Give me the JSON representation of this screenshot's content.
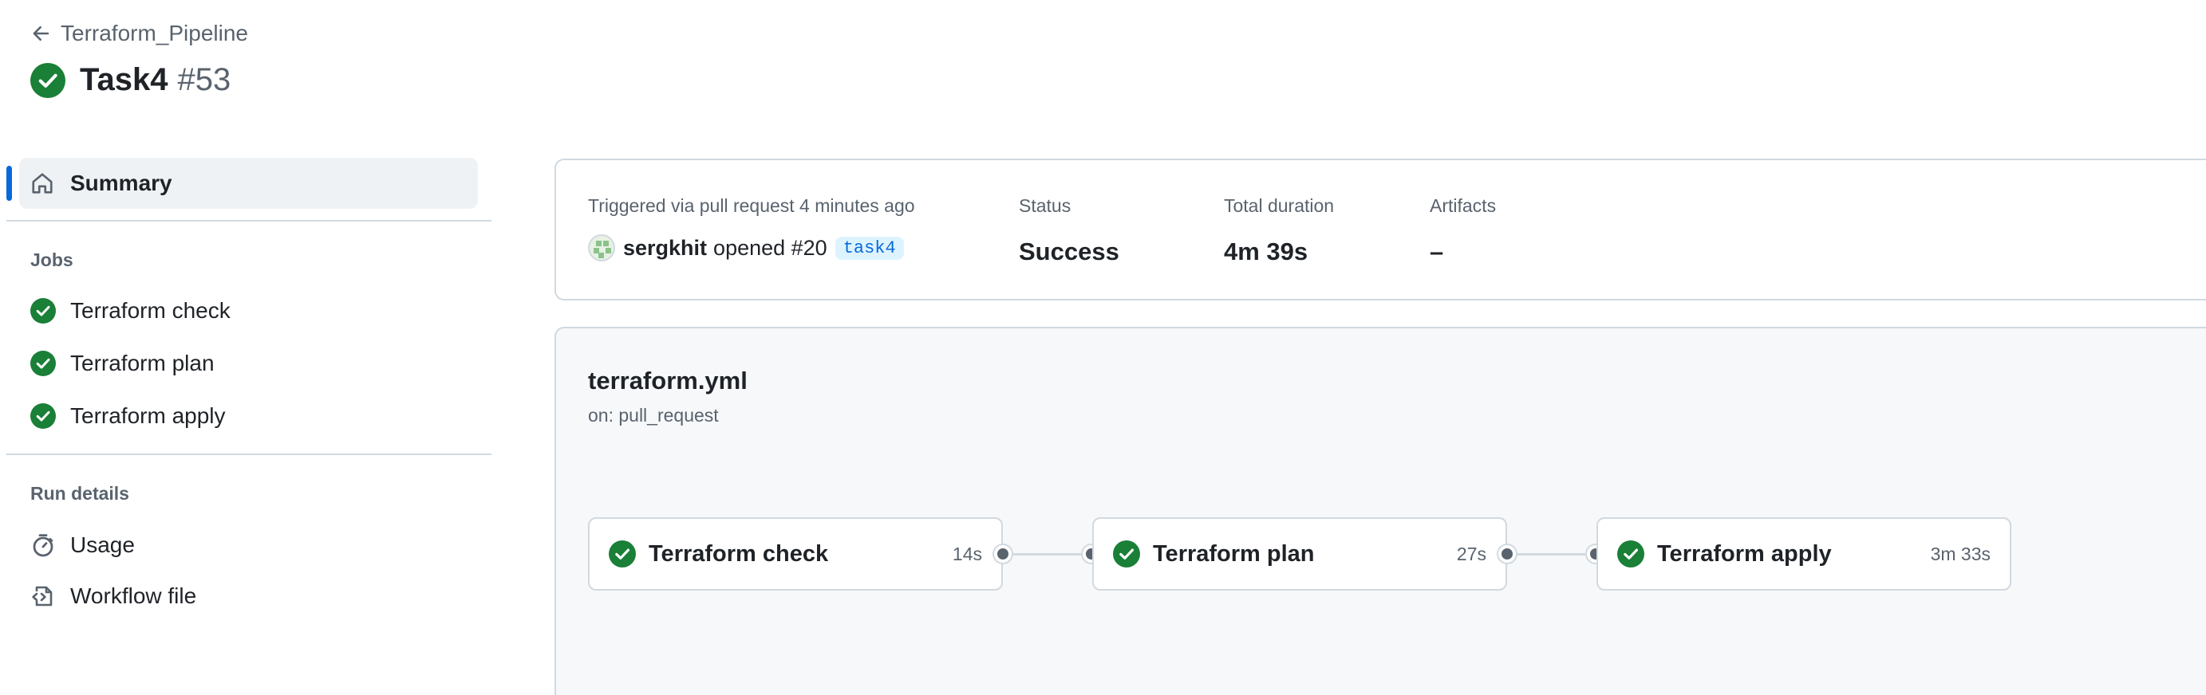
{
  "header": {
    "back_label": "Terraform_Pipeline",
    "run_name": "Task4",
    "run_number": "#53"
  },
  "sidebar": {
    "summary_label": "Summary",
    "jobs_heading": "Jobs",
    "jobs": [
      {
        "label": "Terraform check"
      },
      {
        "label": "Terraform plan"
      },
      {
        "label": "Terraform apply"
      }
    ],
    "run_details_heading": "Run details",
    "usage_label": "Usage",
    "workflow_file_label": "Workflow file"
  },
  "summary": {
    "trigger_label": "Triggered via pull request 4 minutes ago",
    "actor": "sergkhit",
    "action_text": "opened #20",
    "branch": "task4",
    "status_label": "Status",
    "status_value": "Success",
    "duration_label": "Total duration",
    "duration_value": "4m 39s",
    "artifacts_label": "Artifacts",
    "artifacts_value": "–"
  },
  "workflow": {
    "file_name": "terraform.yml",
    "trigger": "on: pull_request",
    "jobs": [
      {
        "name": "Terraform check",
        "duration": "14s"
      },
      {
        "name": "Terraform plan",
        "duration": "27s"
      },
      {
        "name": "Terraform apply",
        "duration": "3m 33s"
      }
    ]
  },
  "colors": {
    "success": "#1a7f37",
    "accent": "#0969da",
    "muted": "#59636e",
    "border": "#d1d9e0"
  },
  "icons": [
    "arrow-left-icon",
    "check-circle-icon",
    "home-icon",
    "stopwatch-icon",
    "workflow-file-icon"
  ]
}
